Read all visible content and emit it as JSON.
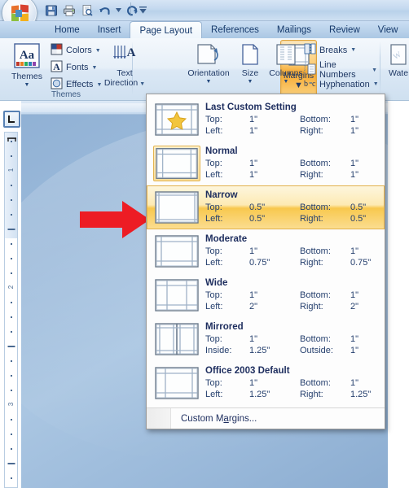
{
  "titlebar": {
    "office_button": "office-button",
    "qat": [
      {
        "name": "save-button",
        "icon": "save-icon",
        "label": "Save"
      },
      {
        "name": "print-button",
        "icon": "print-icon",
        "label": "Print"
      },
      {
        "name": "print-preview-button",
        "icon": "print-preview-icon",
        "label": "Print Preview"
      },
      {
        "name": "undo-button",
        "icon": "undo-icon",
        "label": "Undo"
      },
      {
        "name": "redo-button",
        "icon": "redo-icon",
        "label": "Redo"
      }
    ],
    "customize_label": "Customize Quick Access Toolbar"
  },
  "tabs": [
    {
      "label": "Home",
      "active": false
    },
    {
      "label": "Insert",
      "active": false
    },
    {
      "label": "Page Layout",
      "active": true
    },
    {
      "label": "References",
      "active": false
    },
    {
      "label": "Mailings",
      "active": false
    },
    {
      "label": "Review",
      "active": false
    },
    {
      "label": "View",
      "active": false
    }
  ],
  "ribbon": {
    "groups": [
      {
        "label": "Themes"
      },
      {
        "label": ""
      }
    ],
    "themes_button": "Themes",
    "colors_label": "Colors",
    "fonts_label": "Fonts",
    "effects_label": "Effects",
    "text_direction_label_1": "Text",
    "text_direction_label_2": "Direction",
    "margins_label": "Margins",
    "orientation_label": "Orientation",
    "size_label": "Size",
    "columns_label": "Columns",
    "breaks_label": "Breaks",
    "line_numbers_label": "Line Numbers",
    "hyphenation_label": "Hyphenation",
    "watermark_label": "Wate"
  },
  "ruler": {
    "vertical_numbers": [
      "1",
      "2",
      "3"
    ],
    "tab_selector": "left-tab-stop"
  },
  "margins_menu": {
    "items": [
      {
        "name": "Last Custom Setting",
        "thumb": "star",
        "top_label": "Top:",
        "top_value": "1\"",
        "bottom_label": "Bottom:",
        "bottom_value": "1\"",
        "left_label": "Left:",
        "left_value": "1\"",
        "right_label": "Right:",
        "right_value": "1\"",
        "state": "normal"
      },
      {
        "name": "Normal",
        "thumb": "normal",
        "top_label": "Top:",
        "top_value": "1\"",
        "bottom_label": "Bottom:",
        "bottom_value": "1\"",
        "left_label": "Left:",
        "left_value": "1\"",
        "right_label": "Right:",
        "right_value": "1\"",
        "state": "selected-icon"
      },
      {
        "name": "Narrow",
        "thumb": "narrow",
        "top_label": "Top:",
        "top_value": "0.5\"",
        "bottom_label": "Bottom:",
        "bottom_value": "0.5\"",
        "left_label": "Left:",
        "left_value": "0.5\"",
        "right_label": "Right:",
        "right_value": "0.5\"",
        "state": "hovered"
      },
      {
        "name": "Moderate",
        "thumb": "moderate",
        "top_label": "Top:",
        "top_value": "1\"",
        "bottom_label": "Bottom:",
        "bottom_value": "1\"",
        "left_label": "Left:",
        "left_value": "0.75\"",
        "right_label": "Right:",
        "right_value": "0.75\"",
        "state": "normal"
      },
      {
        "name": "Wide",
        "thumb": "wide",
        "top_label": "Top:",
        "top_value": "1\"",
        "bottom_label": "Bottom:",
        "bottom_value": "1\"",
        "left_label": "Left:",
        "left_value": "2\"",
        "right_label": "Right:",
        "right_value": "2\"",
        "state": "normal"
      },
      {
        "name": "Mirrored",
        "thumb": "mirrored",
        "top_label": "Top:",
        "top_value": "1\"",
        "bottom_label": "Bottom:",
        "bottom_value": "1\"",
        "left_label": "Inside:",
        "left_value": "1.25\"",
        "right_label": "Outside:",
        "right_value": "1\"",
        "state": "normal"
      },
      {
        "name": "Office 2003 Default",
        "thumb": "office2003",
        "top_label": "Top:",
        "top_value": "1\"",
        "bottom_label": "Bottom:",
        "bottom_value": "1\"",
        "left_label": "Left:",
        "left_value": "1.25\"",
        "right_label": "Right:",
        "right_value": "1.25\"",
        "state": "normal"
      }
    ],
    "footer_before": "Custom M",
    "footer_accel": "a",
    "footer_after": "rgins..."
  },
  "annotation": {
    "arrow": "red-right-arrow",
    "arrow_color": "#ED1C24"
  },
  "colors": {
    "accent_orange": "#F6A830",
    "hover_gold": "#F8C84E",
    "text_blue": "#1F3864",
    "ribbon_blue": "#CFE0F0",
    "doc_bg": "#9DBBDB"
  }
}
